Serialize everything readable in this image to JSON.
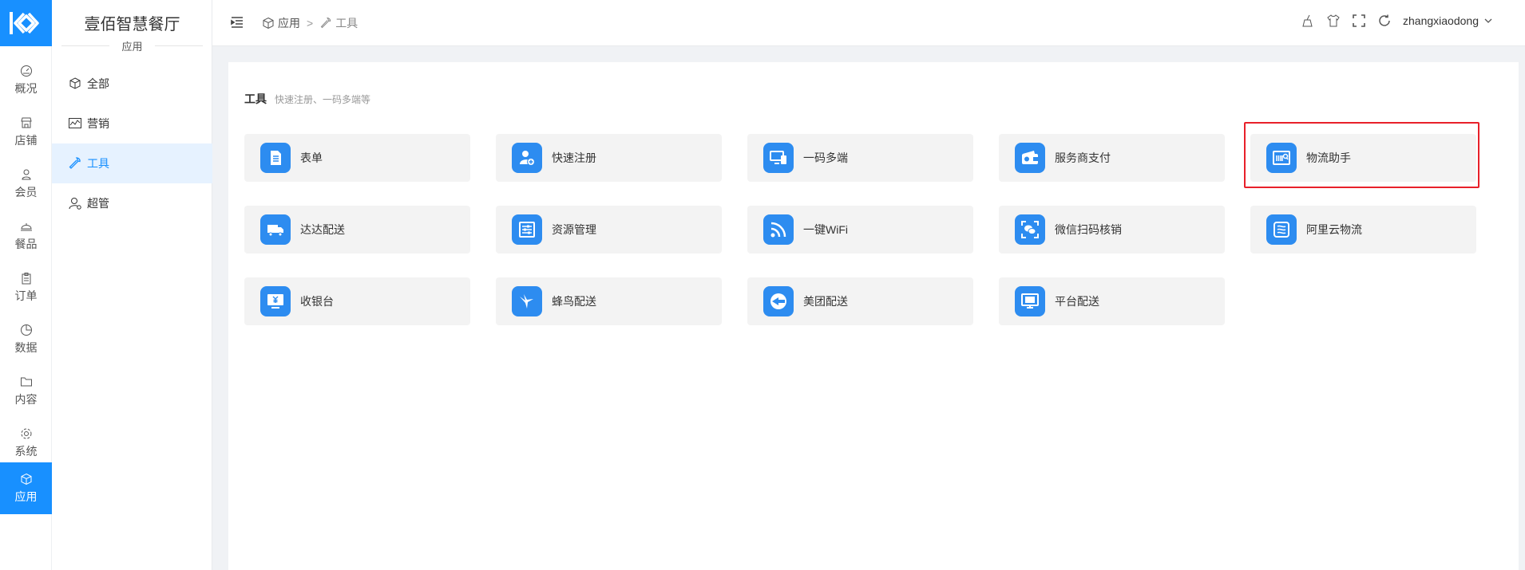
{
  "rail": {
    "items": [
      {
        "label": "概况",
        "icon": "gauge-icon"
      },
      {
        "label": "店铺",
        "icon": "store-icon"
      },
      {
        "label": "会员",
        "icon": "user-icon"
      },
      {
        "label": "餐品",
        "icon": "dish-cover-icon"
      },
      {
        "label": "订单",
        "icon": "clipboard-icon"
      },
      {
        "label": "数据",
        "icon": "pie-chart-icon"
      },
      {
        "label": "内容",
        "icon": "folder-icon"
      },
      {
        "label": "系统",
        "icon": "gear-icon"
      },
      {
        "label": "应用",
        "icon": "cube-icon"
      }
    ]
  },
  "submenu": {
    "title": "壹佰智慧餐厅",
    "subtitle": "应用",
    "items": [
      {
        "label": "全部",
        "icon": "cube-icon"
      },
      {
        "label": "营销",
        "icon": "trend-chart-icon"
      },
      {
        "label": "工具",
        "icon": "wrench-icon"
      },
      {
        "label": "超管",
        "icon": "admin-user-icon"
      }
    ]
  },
  "header": {
    "breadcrumb": [
      "应用",
      "工具"
    ],
    "breadcrumb_sep": ">",
    "username": "zhangxiaodong"
  },
  "main": {
    "section_title": "工具",
    "section_subtitle": "快速注册、一码多端等",
    "tools": [
      {
        "label": "表单",
        "icon": "form-icon"
      },
      {
        "label": "快速注册",
        "icon": "user-add-icon"
      },
      {
        "label": "一码多端",
        "icon": "multi-device-icon"
      },
      {
        "label": "服务商支付",
        "icon": "wallet-icon"
      },
      {
        "label": "物流助手",
        "icon": "barcode-scan-icon"
      },
      {
        "label": "达达配送",
        "icon": "truck-icon"
      },
      {
        "label": "资源管理",
        "icon": "list-settings-icon"
      },
      {
        "label": "一键WiFi",
        "icon": "wifi-icon"
      },
      {
        "label": "微信扫码核销",
        "icon": "wechat-scan-icon"
      },
      {
        "label": "阿里云物流",
        "icon": "cloud-logistics-icon"
      },
      {
        "label": "收银台",
        "icon": "cashier-icon"
      },
      {
        "label": "蜂鸟配送",
        "icon": "hummingbird-icon"
      },
      {
        "label": "美团配送",
        "icon": "meituan-icon"
      },
      {
        "label": "平台配送",
        "icon": "monitor-delivery-icon"
      }
    ]
  },
  "colors": {
    "accent": "#1890ff",
    "tool_icon_bg": "#2d8cf0",
    "highlight": "#e8202a"
  }
}
